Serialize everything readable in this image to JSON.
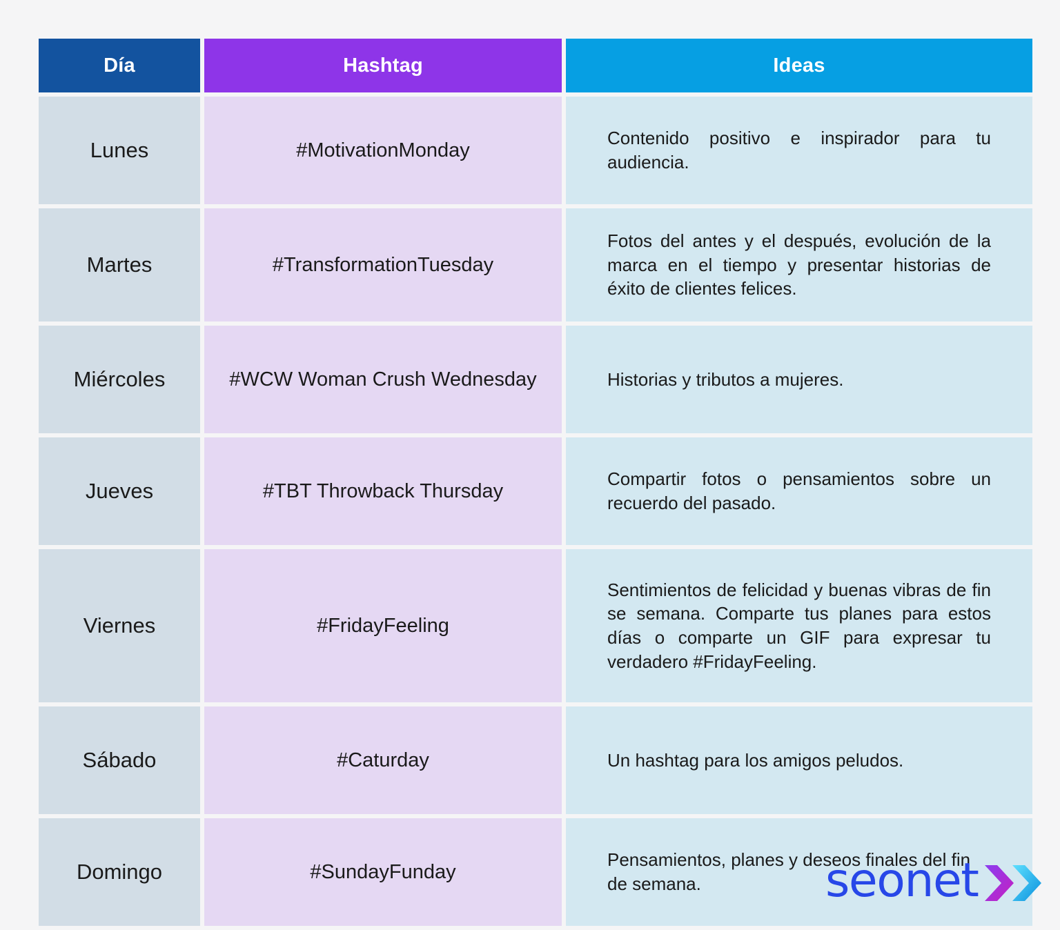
{
  "page": {
    "background_color": "#f5f5f6",
    "text_color": "#1a1a1a"
  },
  "table": {
    "columns": [
      {
        "key": "day",
        "label": "Día",
        "header_color": "#13539f",
        "cell_color": "#d2dde6"
      },
      {
        "key": "tag",
        "label": "Hashtag",
        "header_color": "#8e35e8",
        "cell_color": "#e5d8f3"
      },
      {
        "key": "ideas",
        "label": "Ideas",
        "header_color": "#069fe3",
        "cell_color": "#d3e8f1"
      }
    ],
    "rows": [
      {
        "day": "Lunes",
        "tag": "#MotivationMonday",
        "ideas": "Contenido positivo e inspirador para tu audiencia."
      },
      {
        "day": "Martes",
        "tag": "#TransformationTuesday",
        "ideas": "Fotos del antes y el después, evolución de la marca en el tiempo y presentar historias de éxito de clientes felices."
      },
      {
        "day": "Miércoles",
        "tag": "#WCW Woman Crush Wednesday",
        "ideas": "Historias y tributos a mujeres."
      },
      {
        "day": "Jueves",
        "tag": "#TBT Throwback Thursday",
        "ideas": "Compartir fotos o pensamientos sobre un recuerdo del pasado."
      },
      {
        "day": "Viernes",
        "tag": "#FridayFeeling",
        "ideas": "Sentimientos de felicidad y buenas vibras de fin se semana. Comparte tus planes para estos días o comparte un GIF para expresar tu verdadero #FridayFeeling."
      },
      {
        "day": "Sábado",
        "tag": "#Caturday",
        "ideas": "Un hashtag para los amigos peludos."
      },
      {
        "day": "Domingo",
        "tag": "#SundayFunday",
        "ideas": "Pensamientos, planes y deseos finales del fin de semana."
      }
    ]
  },
  "logo": {
    "wordmark": "seonet",
    "wordmark_color": "#2747e8",
    "chevron_one_colors": [
      "#a21fd0",
      "#8b3ef0"
    ],
    "chevron_two_colors": [
      "#00bff0",
      "#0a8fdc"
    ],
    "icon": "double-chevron-right-icon"
  }
}
